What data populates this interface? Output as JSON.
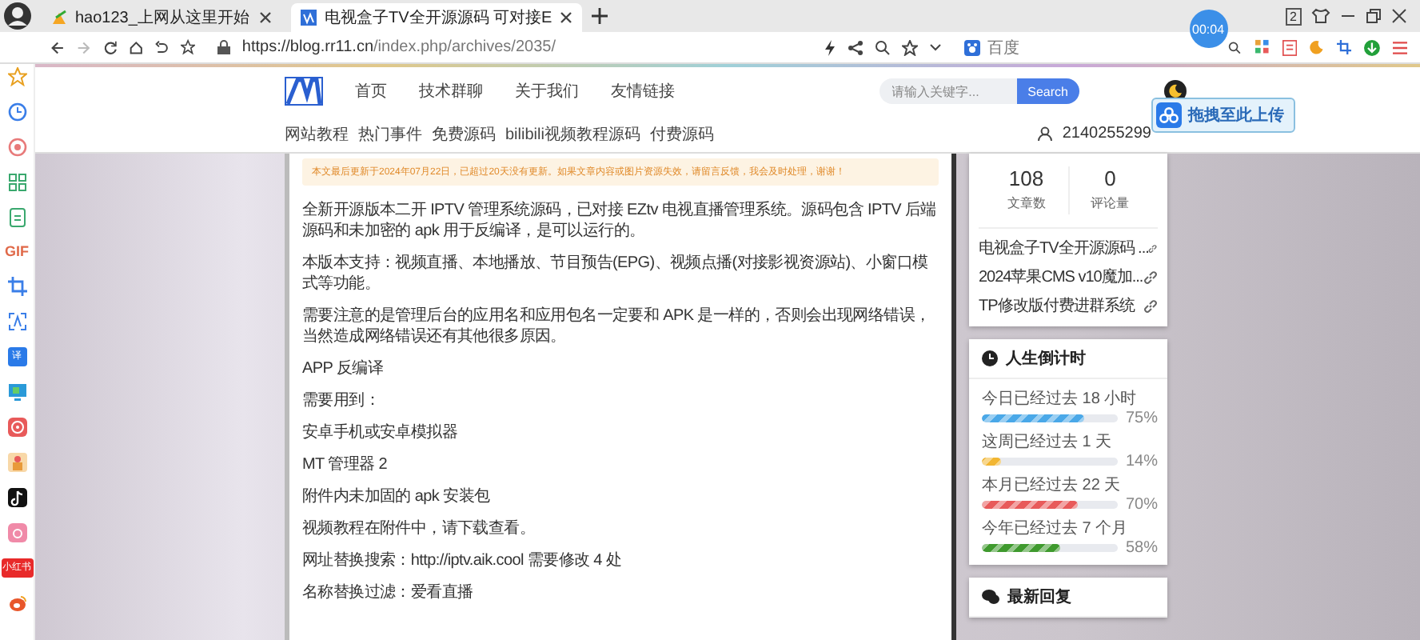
{
  "tabs": [
    {
      "title": "hao123_上网从这里开始",
      "selected": false
    },
    {
      "title": "电视盒子TV全开源源码 可对接E",
      "selected": true
    }
  ],
  "tab_count": "2",
  "timer_badge": "00:04",
  "address_bar": {
    "url_host": "https://blog.rr11.cn",
    "url_path": "/index.php/archives/2035/",
    "search_engine": "百度"
  },
  "browser_sidebar": [
    {
      "kind": "star"
    },
    {
      "kind": "clock"
    },
    {
      "kind": "target"
    },
    {
      "kind": "grid"
    },
    {
      "kind": "doc"
    },
    {
      "kind": "text",
      "label": "GIF"
    },
    {
      "kind": "crop"
    },
    {
      "kind": "scan"
    },
    {
      "kind": "tile",
      "label": "译"
    },
    {
      "kind": "screen"
    },
    {
      "kind": "podcast"
    },
    {
      "kind": "box"
    },
    {
      "kind": "note"
    },
    {
      "kind": "camera"
    },
    {
      "kind": "tile",
      "label": "小红书"
    },
    {
      "kind": "weibo"
    }
  ],
  "site": {
    "nav": [
      "首页",
      "技术群聊",
      "关于我们",
      "友情链接"
    ],
    "search": {
      "placeholder": "请输入关键字...",
      "button": "Search"
    },
    "categories": [
      "网站教程",
      "热门事件",
      "免费源码",
      "bilibili视频教程源码",
      "付费源码"
    ],
    "user": "2140255299",
    "upload_tip": "拖拽至此上传"
  },
  "article": {
    "notice": "本文最后更新于2024年07月22日，已超过20天没有更新。如果文章内容或图片资源失效，请留言反馈，我会及时处理，谢谢！",
    "paragraphs": [
      "全新开源版本二开 IPTV 管理系统源码，已对接 EZtv 电视直播管理系统。源码包含 IPTV 后端源码和未加密的 apk 用于反编译，是可以运行的。",
      "本版本支持：视频直播、本地播放、节目预告(EPG)、视频点播(对接影视资源站)、小窗口模式等功能。",
      "需要注意的是管理后台的应用名和应用包名一定要和 APK 是一样的，否则会出现网络错误，当然造成网络错误还有其他很多原因。",
      "APP 反编译",
      "需要用到：",
      "安卓手机或安卓模拟器",
      "MT 管理器 2",
      "附件内未加固的 apk 安装包",
      "视频教程在附件中，请下载查看。",
      "网址替换搜索：http://iptv.aik.cool 需要修改 4 处",
      "名称替换过滤：爱看直播"
    ]
  },
  "stats": [
    {
      "value": "108",
      "label": "文章数"
    },
    {
      "value": "0",
      "label": "评论量"
    }
  ],
  "recent_posts": [
    "电视盒子TV全开源源码 ...",
    "2024苹果CMS v10魔加...",
    "TP修改版付费进群系统"
  ],
  "countdown": {
    "title": "人生倒计时",
    "items": [
      {
        "label": "今日已经过去 18 小时",
        "level": 0.75,
        "reading": "75%",
        "color": "#4aa8e8"
      },
      {
        "label": "这周已经过去 1 天",
        "level": 0.14,
        "reading": "14%",
        "color": "#f2b632"
      },
      {
        "label": "本月已经过去 22 天",
        "level": 0.7,
        "reading": "70%",
        "color": "#e85a5a"
      },
      {
        "label": "今年已经过去 7 个月",
        "level": 0.58,
        "reading": "58%",
        "color": "#3f9a2e"
      }
    ]
  },
  "latest_replies": {
    "title": "最新回复"
  }
}
